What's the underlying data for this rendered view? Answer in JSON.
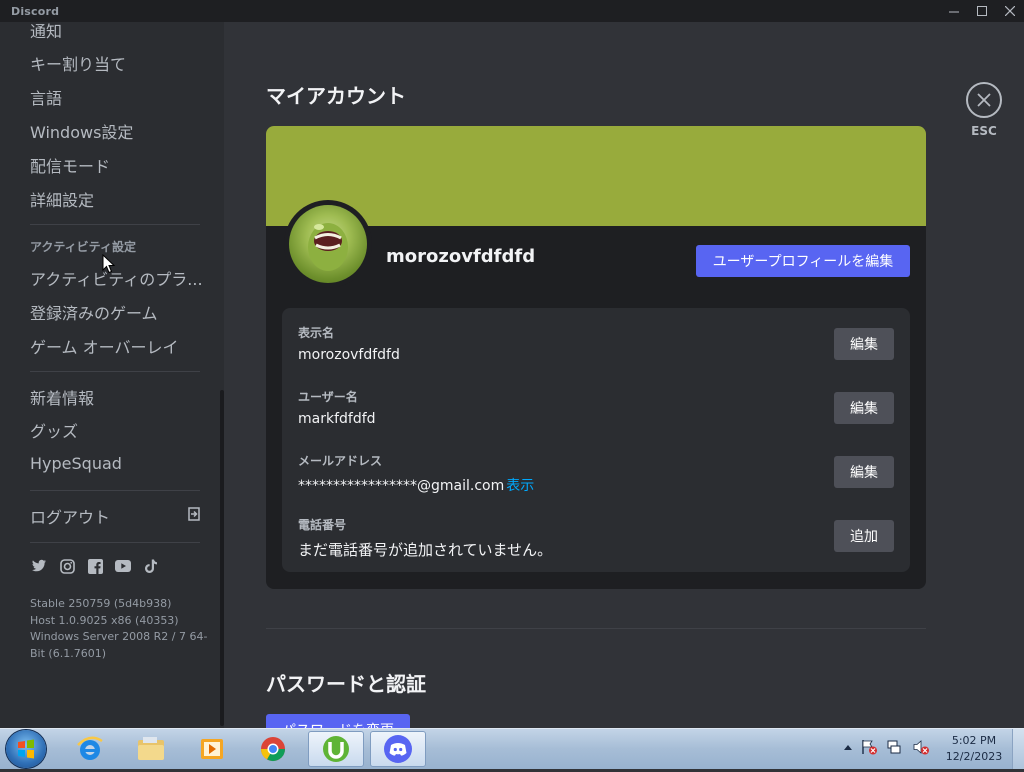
{
  "window": {
    "title": "Discord"
  },
  "sidebar": {
    "items_top": [
      "通知",
      "キー割り当て",
      "言語",
      "Windows設定",
      "配信モード",
      "詳細設定"
    ],
    "activity_header": "アクティビティ設定",
    "activity_items": [
      "アクティビティのプラ...",
      "登録済みのゲーム",
      "ゲーム オーバーレイ"
    ],
    "misc_items": [
      "新着情報",
      "グッズ",
      "HypeSquad"
    ],
    "logout": "ログアウト",
    "social_icons": [
      "twitter-icon",
      "instagram-icon",
      "facebook-icon",
      "youtube-icon",
      "tiktok-icon"
    ],
    "version": {
      "line1": "Stable 250759 (5d4b938)",
      "line2": "Host 1.0.9025 x86 (40353)",
      "line3": "Windows Server 2008 R2 / 7 64-Bit (6.1.7601)"
    }
  },
  "main": {
    "title": "マイアカウント",
    "close_label": "ESC",
    "profile": {
      "display_username": "morozovfdfdfd",
      "edit_profile_button": "ユーザープロフィールを編集",
      "banner_color": "#98ab3c"
    },
    "fields": [
      {
        "label": "表示名",
        "value": "morozovfdfdfd",
        "button": "編集"
      },
      {
        "label": "ユーザー名",
        "value": "markfdfdfd",
        "button": "編集"
      },
      {
        "label": "メールアドレス",
        "value": "*****************@gmail.com",
        "reveal": "表示",
        "button": "編集"
      },
      {
        "label": "電話番号",
        "value": "まだ電話番号が追加されていません。",
        "button": "追加"
      }
    ],
    "password_section_title": "パスワードと認証",
    "change_password_button": "パスワードを変更"
  },
  "taskbar": {
    "apps": [
      "internet-explorer-icon",
      "file-explorer-icon",
      "media-player-icon",
      "chrome-icon",
      "utorrent-icon",
      "discord-icon"
    ],
    "clock_time": "5:02 PM",
    "clock_date": "12/2/2023"
  },
  "colors": {
    "accent": "#5865f2",
    "link": "#00a8fc",
    "background": "#313338",
    "sidebar": "#2b2d31"
  }
}
